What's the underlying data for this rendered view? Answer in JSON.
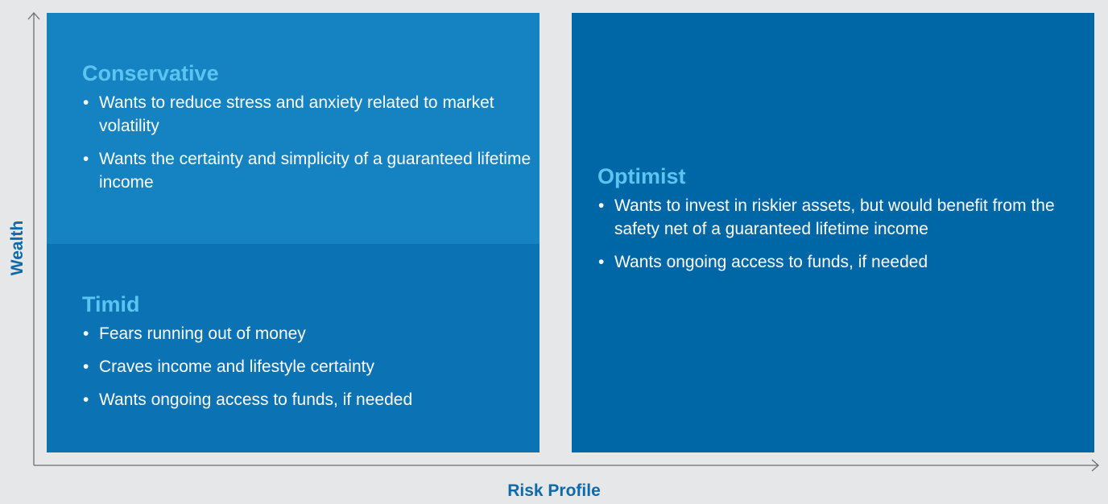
{
  "axes": {
    "y_label": "Wealth",
    "x_label": "Risk Profile"
  },
  "quadrants": {
    "conservative": {
      "title": "Conservative",
      "bullets": [
        "Wants to reduce stress and anxiety related to market volatility",
        "Wants the certainty and simplicity of a guaranteed lifetime income"
      ]
    },
    "timid": {
      "title": "Timid",
      "bullets": [
        "Fears running out of money",
        "Craves income and lifestyle certainty",
        "Wants ongoing access to funds, if needed"
      ]
    },
    "optimist": {
      "title": "Optimist",
      "bullets": [
        "Wants to invest in riskier assets, but would benefit from the safety net of a guaranteed lifetime income",
        "Wants ongoing access to funds, if needed"
      ]
    }
  },
  "colors": {
    "background": "#e6e7e8",
    "conservative_panel": "#1583c1",
    "timid_panel": "#0b72b4",
    "optimist_panel": "#0067a7",
    "heading": "#5bc4f0",
    "axis_label": "#0e6aa8",
    "axis_line": "#6d6e71"
  },
  "bullet_glyph": "•"
}
